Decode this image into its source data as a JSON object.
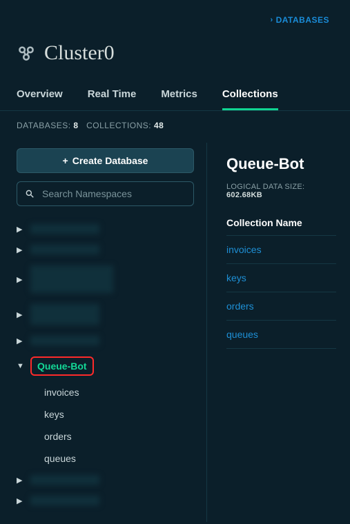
{
  "breadcrumb": {
    "label": "DATABASES"
  },
  "cluster": {
    "name": "Cluster0"
  },
  "tabs": [
    {
      "label": "Overview",
      "active": false
    },
    {
      "label": "Real Time",
      "active": false
    },
    {
      "label": "Metrics",
      "active": false
    },
    {
      "label": "Collections",
      "active": true
    }
  ],
  "stats": {
    "db_label": "DATABASES:",
    "db_count": "8",
    "coll_label": "COLLECTIONS:",
    "coll_count": "48"
  },
  "sidebar": {
    "create_label": "Create Database",
    "search_placeholder": "Search Namespaces",
    "selected_db": "Queue-Bot",
    "sub_items": [
      "invoices",
      "keys",
      "orders",
      "queues"
    ]
  },
  "detail": {
    "title": "Queue-Bot",
    "meta_label": "LOGICAL DATA SIZE:",
    "meta_value": "602.68KB",
    "col_header": "Collection Name",
    "collections": [
      "invoices",
      "keys",
      "orders",
      "queues"
    ]
  }
}
